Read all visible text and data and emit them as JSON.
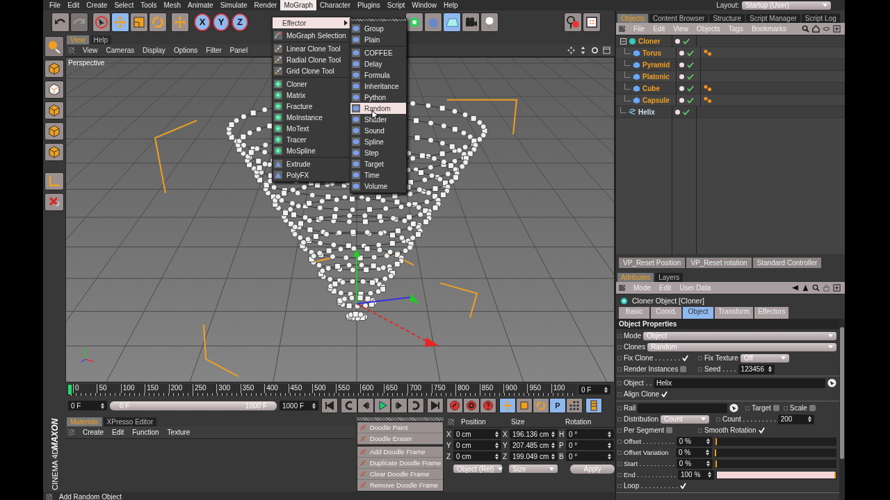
{
  "menubar": [
    {
      "label": "File",
      "selected": false
    },
    {
      "label": "Edit",
      "selected": false
    },
    {
      "label": "Create",
      "selected": false
    },
    {
      "label": "Select",
      "selected": false
    },
    {
      "label": "Tools",
      "selected": false
    },
    {
      "label": "Mesh",
      "selected": false
    },
    {
      "label": "Animate",
      "selected": false
    },
    {
      "label": "Simulate",
      "selected": false
    },
    {
      "label": "Render",
      "selected": false
    },
    {
      "label": "MoGraph",
      "selected": true
    },
    {
      "label": "Character",
      "selected": false
    },
    {
      "label": "Plugins",
      "selected": false
    },
    {
      "label": "Script",
      "selected": false
    },
    {
      "label": "Window",
      "selected": false
    },
    {
      "label": "Help",
      "selected": false
    }
  ],
  "layout": {
    "label": "Layout:",
    "value": "Startup (User)"
  },
  "toolbar": {
    "axis_buttons": [
      "X",
      "Y",
      "Z"
    ]
  },
  "viewport": {
    "tabs": [
      {
        "label": "View",
        "selected": true
      },
      {
        "label": "Help",
        "selected": false
      }
    ],
    "menu": [
      "View",
      "Cameras",
      "Display",
      "Options",
      "Filter",
      "Panel"
    ],
    "camera": "Perspective"
  },
  "mograph_menu": {
    "submenu": {
      "label": "Effector",
      "selected": true
    },
    "groups": [
      [
        "MoGraph Selection"
      ],
      [
        "Linear Clone Tool",
        "Radial Clone Tool",
        "Grid Clone Tool"
      ],
      [
        "Cloner",
        "Matrix",
        "Fracture",
        "MoInstance",
        "MoText",
        "Tracer",
        "MoSpline"
      ],
      [
        "Extrude",
        "PolyFX"
      ]
    ]
  },
  "effector_menu": {
    "groups": [
      [
        {
          "label": "Group",
          "selected": false
        },
        {
          "label": "Plain",
          "selected": false
        }
      ],
      [
        {
          "label": "COFFEE",
          "selected": false
        },
        {
          "label": "Delay",
          "selected": false
        },
        {
          "label": "Formula",
          "selected": false
        },
        {
          "label": "Inheritance",
          "selected": false
        },
        {
          "label": "Python",
          "selected": false
        },
        {
          "label": "Random",
          "selected": true
        },
        {
          "label": "Shader",
          "selected": false
        },
        {
          "label": "Sound",
          "selected": false
        },
        {
          "label": "Spline",
          "selected": false
        },
        {
          "label": "Step",
          "selected": false
        },
        {
          "label": "Target",
          "selected": false
        },
        {
          "label": "Time",
          "selected": false
        },
        {
          "label": "Volume",
          "selected": false
        }
      ]
    ]
  },
  "timeline": {
    "ticks": [
      "0",
      "50",
      "100",
      "150",
      "200",
      "250",
      "300",
      "350",
      "400",
      "450",
      "500",
      "550",
      "600",
      "650",
      "700",
      "750",
      "800",
      "850",
      "900",
      "950",
      "100"
    ],
    "current_frame": "0 F",
    "start": "0 F",
    "range": {
      "start": "0 F",
      "end": "1000 F",
      "level": 1
    },
    "end": "1000 F",
    "param_button": "P"
  },
  "materials": {
    "tabs": [
      {
        "label": "Materials",
        "selected": true
      },
      {
        "label": "XPresso Editor",
        "selected": false
      }
    ],
    "menu": [
      "Create",
      "Edit",
      "Function",
      "Texture"
    ]
  },
  "doodle": {
    "groups": [
      [
        "Doodle Paint",
        "Doodle Eraser"
      ],
      [
        "Add Doodle Frame",
        "Duplicate Doodle Frame",
        "Clear Doodle Frame",
        "Remove Doodle Frame"
      ]
    ]
  },
  "coordinates": {
    "headers": [
      "Position",
      "Size",
      "Rotation"
    ],
    "rows": [
      {
        "pos_axis": "X",
        "position": "0 cm",
        "size_axis": "X",
        "size": "196.136 cm",
        "rot_axis": "H",
        "rotation": "0 °"
      },
      {
        "pos_axis": "Y",
        "position": "0 cm",
        "size_axis": "Y",
        "size": "207.485 cm",
        "rot_axis": "P",
        "rotation": "0 °"
      },
      {
        "pos_axis": "Z",
        "position": "0 cm",
        "size_axis": "Z",
        "size": "199.049 cm",
        "rot_axis": "B",
        "rotation": "0 °"
      }
    ],
    "mode": "Object (Rel)",
    "size_mode": "Size",
    "apply": "Apply"
  },
  "status": "Add Random Object",
  "logo": {
    "brand": "MAXON",
    "product": "CINEMA 4D"
  },
  "object_manager": {
    "tabs": [
      {
        "label": "Objects",
        "selected": true
      },
      {
        "label": "Content Browser",
        "selected": false
      },
      {
        "label": "Structure",
        "selected": false
      },
      {
        "label": "Script Manager",
        "selected": false
      },
      {
        "label": "Script Log",
        "selected": false
      }
    ],
    "menu": [
      "File",
      "Edit",
      "View",
      "Objects",
      "Tags",
      "Bookmarks"
    ],
    "tree": [
      {
        "name": "Cloner",
        "selected": true,
        "tag": false,
        "children": [
          {
            "name": "Torus",
            "selected": true,
            "tag": true
          },
          {
            "name": "Pyramid",
            "selected": true,
            "tag": false
          },
          {
            "name": "Platonic",
            "selected": true,
            "tag": false
          },
          {
            "name": "Cube",
            "selected": true,
            "tag": true
          },
          {
            "name": "Capsule",
            "selected": true,
            "tag": true
          }
        ]
      },
      {
        "name": "Helix",
        "selected": false,
        "tag": false
      }
    ]
  },
  "script_buttons": [
    "VP_Reset Position",
    "VP_Reset rotation",
    "Standard Controller"
  ],
  "attributes": {
    "tabs": [
      {
        "label": "Attributes",
        "selected": true
      },
      {
        "label": "Layers",
        "selected": false
      }
    ],
    "menu": [
      "Mode",
      "Edit",
      "User Data"
    ],
    "title": "Cloner Object [Cloner]",
    "section_tabs": [
      {
        "label": "Basic",
        "selected": false
      },
      {
        "label": "Coord.",
        "selected": false
      },
      {
        "label": "Object",
        "selected": true
      },
      {
        "label": "Transform",
        "selected": false
      },
      {
        "label": "Effectors",
        "selected": false
      }
    ],
    "section": "Object Properties",
    "groups": [
      [
        [
          {
            "kind": "dropdown",
            "label": "Mode",
            "value": "Object"
          }
        ],
        [
          {
            "kind": "dropdown",
            "label": "Clones",
            "value": "Random"
          }
        ],
        [
          {
            "kind": "checkbox",
            "label": "Fix Clone . . . . . . .",
            "checked": true
          },
          {
            "kind": "dropdown",
            "label": "Fix Texture",
            "value": "Off"
          }
        ],
        [
          {
            "kind": "checkbox",
            "label": "Render Instances",
            "checked": false
          },
          {
            "kind": "number",
            "label": "Seed . . . .",
            "value": "123456"
          }
        ]
      ],
      [
        [
          {
            "kind": "link",
            "label": "Object . .",
            "value": "Helix"
          }
        ],
        [
          {
            "kind": "checkbox",
            "label": "Align Clone",
            "checked": true
          }
        ]
      ],
      [
        [
          {
            "kind": "link",
            "label": "Rail"
          },
          {
            "kind": "checkbox",
            "label": "Target",
            "checked": false
          },
          {
            "kind": "checkbox",
            "label": "Scale",
            "checked": false
          }
        ],
        [
          {
            "kind": "dropdown",
            "label": "Distribution",
            "value": "Count"
          },
          {
            "kind": "number",
            "label": "Count . . . . . . . . .",
            "value": "200"
          }
        ],
        [
          {
            "kind": "checkbox",
            "label": "Per Segment",
            "checked": false
          },
          {
            "kind": "checkbox",
            "label": "Smooth Rotation",
            "checked": true
          }
        ],
        [
          {
            "kind": "slider",
            "label": "Offset . . . . . . . . .",
            "value": "0 %",
            "level": 0
          }
        ],
        [
          {
            "kind": "slider",
            "label": "Offset Variation",
            "value": "0 %",
            "level": 0
          }
        ],
        [
          {
            "kind": "slider",
            "label": "Start . . . . . . . . . .",
            "value": "0 %",
            "level": 0
          }
        ],
        [
          {
            "kind": "slider",
            "label": "End . . . . . . . . . . .",
            "value": "100 %",
            "level": 1
          }
        ],
        [
          {
            "kind": "checkbox",
            "label": "Loop . . . . . . . . . .",
            "checked": true
          }
        ]
      ]
    ]
  }
}
